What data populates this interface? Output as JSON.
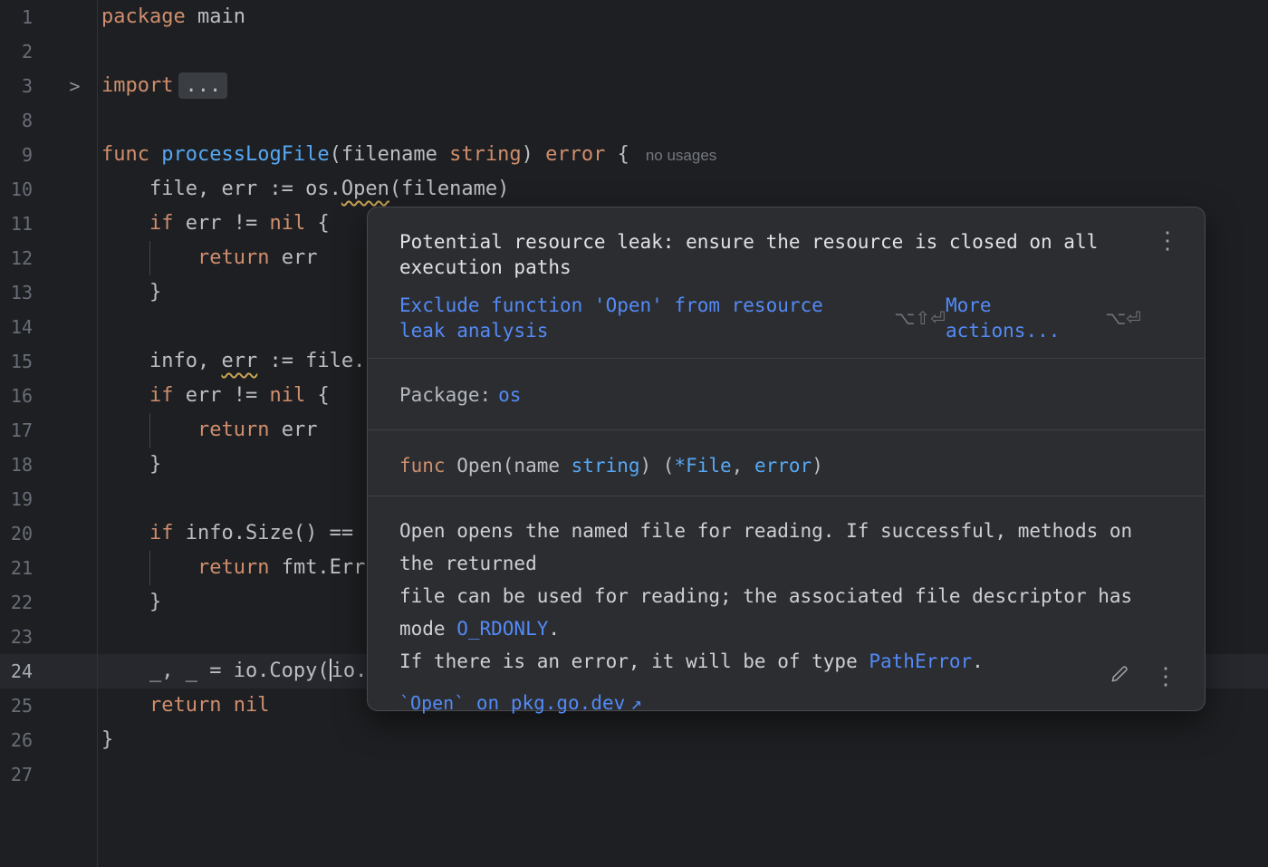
{
  "colors": {
    "editor_bg": "#1e1f22",
    "popup_bg": "#2b2d30",
    "accent_link_blue": "#548af7",
    "keyword_orange": "#cf8e6d",
    "function_blue": "#56a8f5",
    "warning_underline_yellow": "#c9a554",
    "current_line_bg": "#26282e"
  },
  "editor": {
    "lines": [
      {
        "num": "1",
        "segs": [
          {
            "t": "package",
            "s": "kw"
          },
          {
            "t": " main",
            "s": "pl"
          }
        ]
      },
      {
        "num": "2",
        "segs": []
      },
      {
        "num": "3",
        "fold": true,
        "segs": [
          {
            "t": "import",
            "s": "kw"
          },
          {
            "t": "...",
            "s": "folded"
          }
        ]
      },
      {
        "num": "8",
        "segs": []
      },
      {
        "num": "9",
        "segs": [
          {
            "t": "func ",
            "s": "kw"
          },
          {
            "t": "processLogFile",
            "s": "fn"
          },
          {
            "t": "(filename ",
            "s": "pl"
          },
          {
            "t": "string",
            "s": "kw"
          },
          {
            "t": ") ",
            "s": "pl"
          },
          {
            "t": "error",
            "s": "kw"
          },
          {
            "t": " {",
            "s": "pl"
          },
          {
            "t": "no usages",
            "s": "hint"
          }
        ]
      },
      {
        "num": "10",
        "segs": [
          {
            "t": "    file, err := os.",
            "s": "pl"
          },
          {
            "t": "Open",
            "s": "warn"
          },
          {
            "t": "(filename)",
            "s": "pl"
          }
        ]
      },
      {
        "num": "11",
        "segs": [
          {
            "t": "    ",
            "s": "pl"
          },
          {
            "t": "if",
            "s": "kw"
          },
          {
            "t": " err != ",
            "s": "pl"
          },
          {
            "t": "nil",
            "s": "kw"
          },
          {
            "t": " {",
            "s": "pl"
          }
        ]
      },
      {
        "num": "12",
        "guide": true,
        "segs": [
          {
            "t": "        ",
            "s": "pl"
          },
          {
            "t": "return",
            "s": "kw"
          },
          {
            "t": " err",
            "s": "pl"
          }
        ]
      },
      {
        "num": "13",
        "segs": [
          {
            "t": "    }",
            "s": "pl"
          }
        ]
      },
      {
        "num": "14",
        "segs": []
      },
      {
        "num": "15",
        "segs": [
          {
            "t": "    info, ",
            "s": "pl"
          },
          {
            "t": "err",
            "s": "warn"
          },
          {
            "t": " := file.",
            "s": "pl"
          }
        ]
      },
      {
        "num": "16",
        "segs": [
          {
            "t": "    ",
            "s": "pl"
          },
          {
            "t": "if",
            "s": "kw"
          },
          {
            "t": " err != ",
            "s": "pl"
          },
          {
            "t": "nil",
            "s": "kw"
          },
          {
            "t": " {",
            "s": "pl"
          }
        ]
      },
      {
        "num": "17",
        "guide": true,
        "segs": [
          {
            "t": "        ",
            "s": "pl"
          },
          {
            "t": "return",
            "s": "kw"
          },
          {
            "t": " err",
            "s": "pl"
          }
        ]
      },
      {
        "num": "18",
        "segs": [
          {
            "t": "    }",
            "s": "pl"
          }
        ]
      },
      {
        "num": "19",
        "segs": []
      },
      {
        "num": "20",
        "segs": [
          {
            "t": "    ",
            "s": "pl"
          },
          {
            "t": "if",
            "s": "kw"
          },
          {
            "t": " info.Size() ==",
            "s": "pl"
          }
        ]
      },
      {
        "num": "21",
        "guide": true,
        "segs": [
          {
            "t": "        ",
            "s": "pl"
          },
          {
            "t": "return",
            "s": "kw"
          },
          {
            "t": " fmt.Err",
            "s": "pl"
          }
        ]
      },
      {
        "num": "22",
        "segs": [
          {
            "t": "    }",
            "s": "pl"
          }
        ]
      },
      {
        "num": "23",
        "segs": []
      },
      {
        "num": "24",
        "current": true,
        "segs": [
          {
            "t": "    _, _ = io.Copy(",
            "s": "pl"
          },
          {
            "s": "caret"
          },
          {
            "t": "io.",
            "s": "pl"
          }
        ]
      },
      {
        "num": "25",
        "segs": [
          {
            "t": "    ",
            "s": "pl"
          },
          {
            "t": "return",
            "s": "kw"
          },
          {
            "t": " ",
            "s": "pl"
          },
          {
            "t": "nil",
            "s": "kw"
          }
        ]
      },
      {
        "num": "26",
        "segs": [
          {
            "t": "}",
            "s": "pl"
          }
        ]
      },
      {
        "num": "27",
        "segs": []
      }
    ]
  },
  "popup": {
    "title": "Potential resource leak: ensure the resource is closed on all execution paths",
    "kebab_icon": "⋮",
    "action_link": "Exclude function 'Open' from resource leak analysis",
    "action_shortcut": "⌥⇧⏎",
    "more_actions": "More actions...",
    "more_shortcut": "⌥⏎",
    "package_label": "Package:",
    "package_name": "os",
    "signature": [
      {
        "t": "func ",
        "s": "kw"
      },
      {
        "t": "Open(name ",
        "s": "pl"
      },
      {
        "t": "string",
        "s": "type"
      },
      {
        "t": ") (",
        "s": "pl"
      },
      {
        "t": "*File",
        "s": "type"
      },
      {
        "t": ", ",
        "s": "pl"
      },
      {
        "t": "error",
        "s": "type"
      },
      {
        "t": ")",
        "s": "pl"
      }
    ],
    "doc_lines": [
      [
        {
          "t": "Open opens the named file for reading. If successful, methods on the returned"
        }
      ],
      [
        {
          "t": "file can be used for reading; the associated file descriptor has mode "
        },
        {
          "t": "O_RDONLY",
          "link": true
        },
        {
          "t": "."
        }
      ],
      [
        {
          "t": "If there is an error, it will be of type "
        },
        {
          "t": "PathError",
          "link": true
        },
        {
          "t": "."
        }
      ]
    ],
    "pkg_link_code": "`Open`",
    "pkg_link_rest": " on pkg.go.dev",
    "external_arrow": "↗"
  }
}
